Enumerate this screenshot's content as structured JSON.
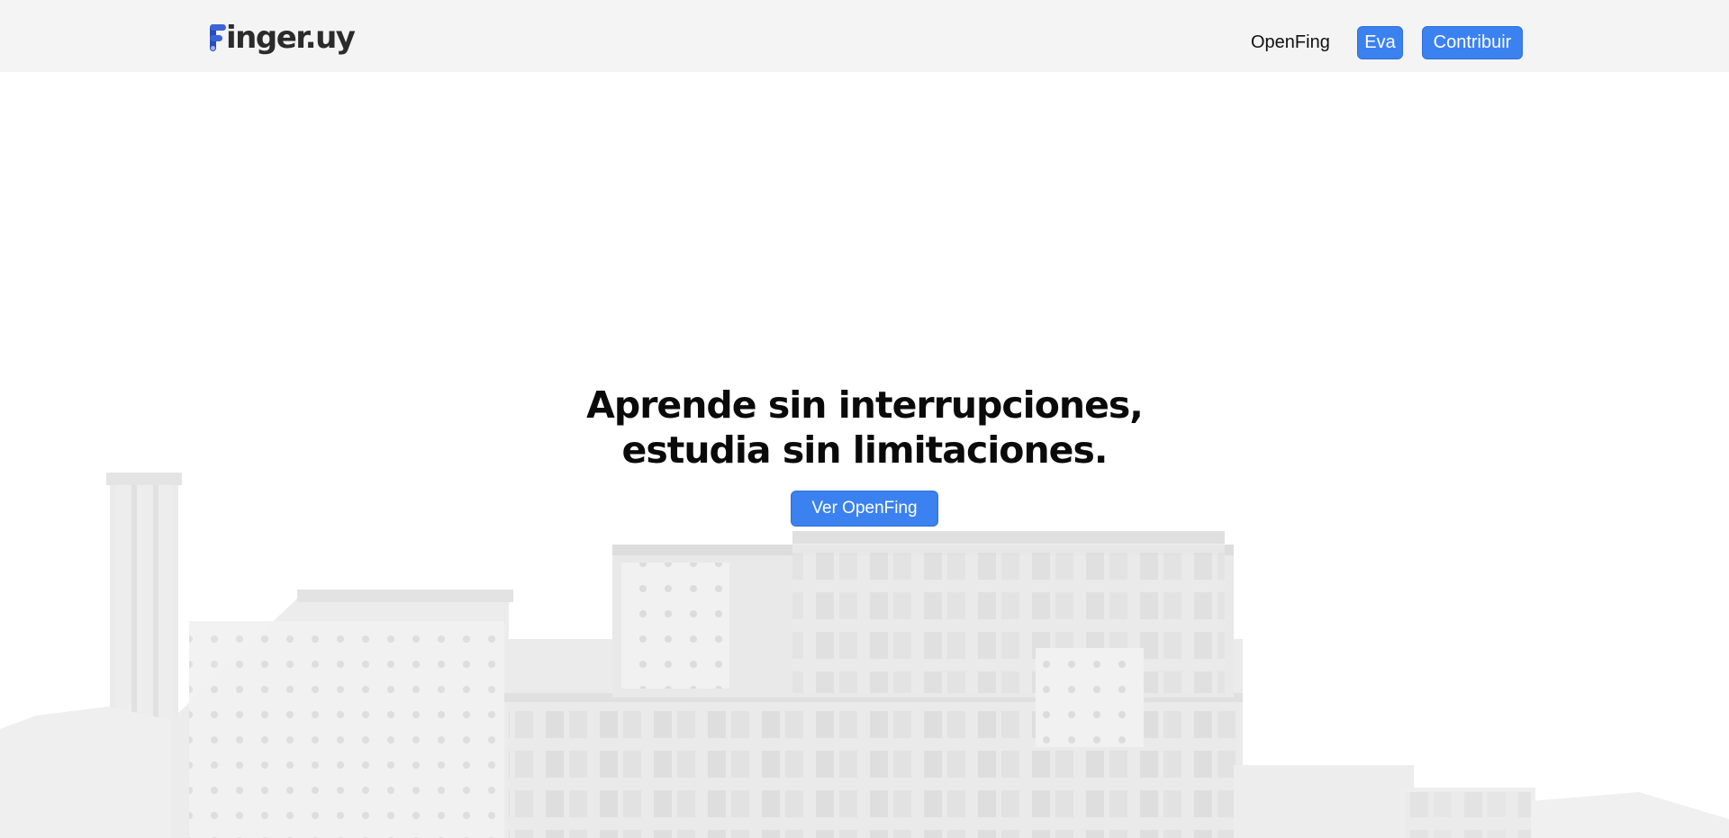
{
  "brand": {
    "logo_text": "inger.uy",
    "logo_icon": "finger-logo-icon"
  },
  "nav": {
    "openfing_link": "OpenFing",
    "eva_button": "Eva",
    "contribuir_button": "Contribuir"
  },
  "hero": {
    "headline_line1": "Aprende sin interrupciones,",
    "headline_line2": "estudia sin limitaciones.",
    "cta_label": "Ver OpenFing",
    "background_image": "faculty-building-illustration"
  },
  "colors": {
    "accent": "#3b82f0",
    "navbar_bg": "#f4f4f4",
    "logo_blue": "#2a4cb6"
  }
}
